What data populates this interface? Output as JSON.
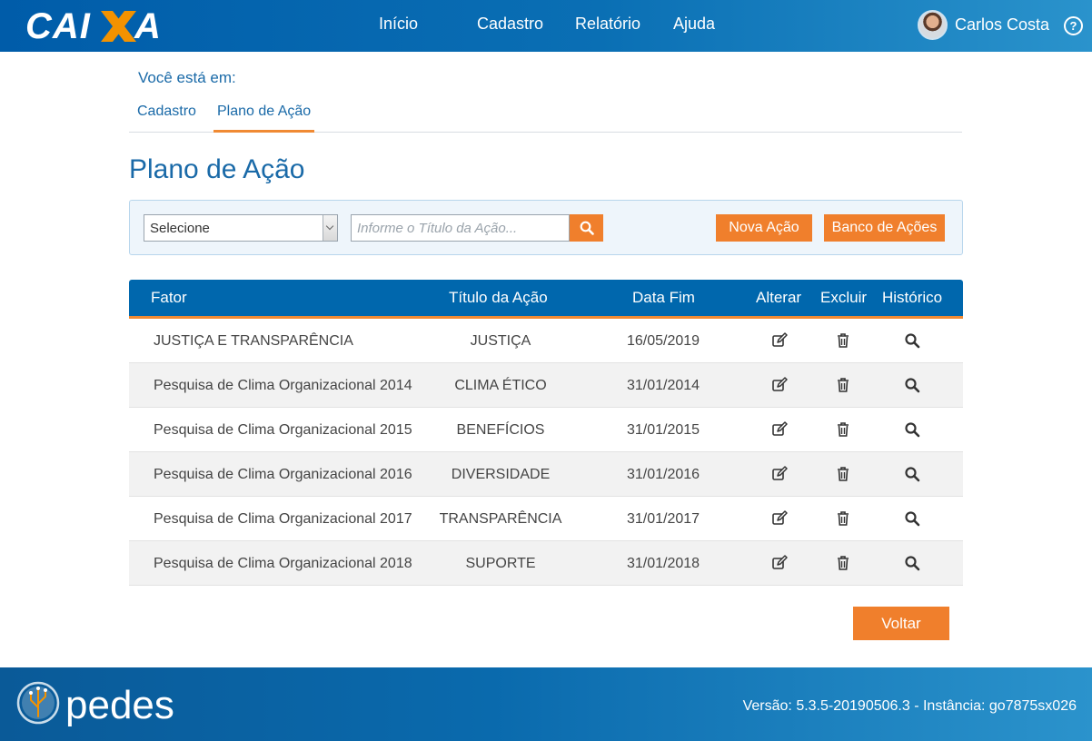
{
  "header": {
    "brand": "CAIXA",
    "nav": [
      "Início",
      "Cadastro",
      "Relatório",
      "Ajuda"
    ],
    "user_name": "Carlos Costa",
    "help_glyph": "?"
  },
  "breadcrumb": {
    "label": "Você está em:",
    "items": [
      "Cadastro",
      "Plano de Ação"
    ]
  },
  "page_title": "Plano de Ação",
  "filter": {
    "select_value": "Selecione",
    "search_placeholder": "Informe o Título da Ação...",
    "nova_acao": "Nova Ação",
    "banco_acoes": "Banco de Ações"
  },
  "table": {
    "headers": [
      "Fator",
      "Título da Ação",
      "Data Fim",
      "Alterar",
      "Excluir",
      "Histórico"
    ],
    "rows": [
      {
        "fator": "JUSTIÇA E TRANSPARÊNCIA",
        "titulo": "JUSTIÇA",
        "data": "16/05/2019"
      },
      {
        "fator": "Pesquisa de Clima Organizacional 2014",
        "titulo": "CLIMA ÉTICO",
        "data": "31/01/2014"
      },
      {
        "fator": "Pesquisa de Clima Organizacional 2015",
        "titulo": "BENEFÍCIOS",
        "data": "31/01/2015"
      },
      {
        "fator": "Pesquisa de Clima Organizacional 2016",
        "titulo": "DIVERSIDADE",
        "data": "31/01/2016"
      },
      {
        "fator": "Pesquisa de Clima Organizacional 2017",
        "titulo": "TRANSPARÊNCIA",
        "data": "31/01/2017"
      },
      {
        "fator": "Pesquisa de Clima Organizacional 2018",
        "titulo": "SUPORTE",
        "data": "31/01/2018"
      }
    ]
  },
  "voltar": "Voltar",
  "footer": {
    "brand": "pedes",
    "version_text": "Versão: 5.3.5-20190506.3 - Instância: go7875sx026"
  },
  "colors": {
    "primary": "#0067ad",
    "accent": "#f07f2c",
    "brand_orange": "#f39200"
  },
  "icons": {
    "edit": "edit-icon",
    "delete": "trash-icon",
    "history": "search-icon",
    "help": "help-circle-icon"
  }
}
